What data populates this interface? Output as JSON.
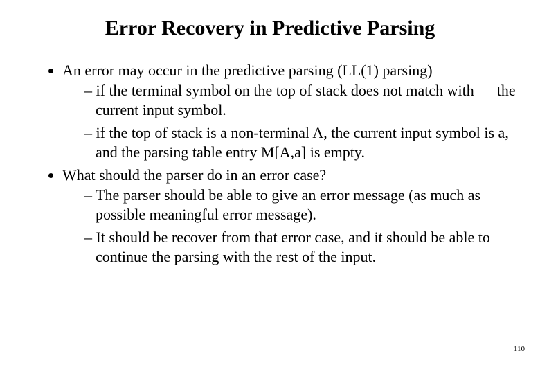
{
  "title": "Error Recovery in Predictive Parsing",
  "bullets": [
    {
      "text": "An error may occur in the predictive parsing (LL(1) parsing)",
      "sub": [
        "if the terminal symbol on the top of stack does not match with      the current input symbol.",
        "if the top of stack is a non-terminal A, the current input symbol is a, and the parsing table entry M[A,a] is empty."
      ]
    },
    {
      "text": "What should the parser do in an error case?",
      "sub": [
        "The parser should be able to give an error message (as much as possible meaningful error message).",
        "It should be recover from that error case, and it should be able to continue the parsing with the rest of the input."
      ]
    }
  ],
  "page_number": "110"
}
